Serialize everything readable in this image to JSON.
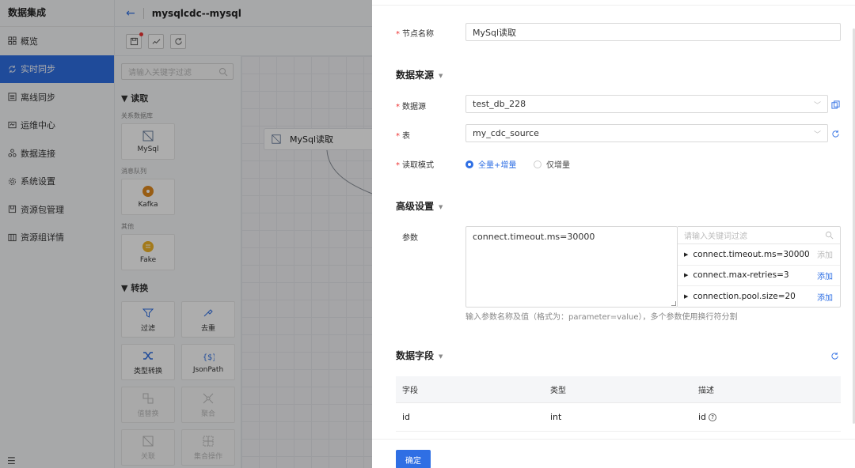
{
  "sidebar": {
    "brand": "数据集成",
    "items": [
      {
        "label": "概览",
        "icon": "grid-icon"
      },
      {
        "label": "实时同步",
        "icon": "sync-icon",
        "active": true
      },
      {
        "label": "离线同步",
        "icon": "list-icon"
      },
      {
        "label": "运维中心",
        "icon": "monitor-icon"
      },
      {
        "label": "数据连接",
        "icon": "link-icon"
      },
      {
        "label": "系统设置",
        "icon": "gear-icon"
      },
      {
        "label": "资源包管理",
        "icon": "package-icon"
      },
      {
        "label": "资源组详情",
        "icon": "columns-icon"
      }
    ],
    "menu_toggle": "☰"
  },
  "topbar": {
    "back": "←",
    "title": "mysqlcdc--mysql"
  },
  "palette": {
    "search_placeholder": "请输入关键字过滤",
    "read_section": "▼ 读取",
    "relational_db": "关系数据库",
    "mysql": "MySql",
    "message_queue": "消息队列",
    "kafka": "Kafka",
    "other": "其他",
    "fake": "Fake",
    "transform_section": "▼ 转换",
    "filter": "过滤",
    "dedup": "去重",
    "type_convert": "类型转换",
    "jsonpath": "JsonPath",
    "value_replace": "值替换",
    "aggregate": "聚合",
    "join": "关联",
    "set_op": "集合操作"
  },
  "canvas": {
    "node_label": "MySql读取"
  },
  "drawer": {
    "node_name_label": "节点名称",
    "node_name_value": "MySql读取",
    "source_group": "数据来源",
    "datasource_label": "数据源",
    "datasource_value": "test_db_228",
    "table_label": "表",
    "table_value": "my_cdc_source",
    "read_mode_label": "读取模式",
    "read_mode_full": "全量+增量",
    "read_mode_incr": "仅增量",
    "advanced_group": "高级设置",
    "params_label": "参数",
    "params_value": "connect.timeout.ms=30000",
    "params_search_placeholder": "请输入关键词过滤",
    "suggestions": [
      {
        "text": "connect.timeout.ms=30000",
        "add": "添加",
        "disabled": true
      },
      {
        "text": "connect.max-retries=3",
        "add": "添加",
        "disabled": false
      },
      {
        "text": "connection.pool.size=20",
        "add": "添加",
        "disabled": false
      }
    ],
    "params_hint": "输入参数名称及值（格式为：parameter=value），多个参数使用换行符分割",
    "fields_group": "数据字段",
    "table_headers": [
      "字段",
      "类型",
      "描述"
    ],
    "rows": [
      {
        "field": "id",
        "type": "int",
        "desc": "id"
      }
    ],
    "confirm": "确定"
  },
  "colors": {
    "accent": "#2f6fe4",
    "required": "#e33333"
  }
}
